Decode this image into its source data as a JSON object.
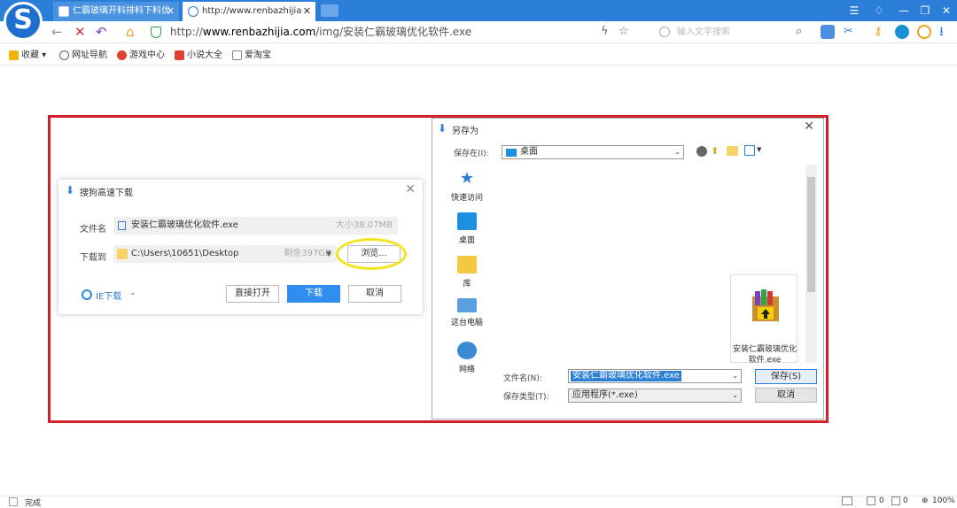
{
  "browser": {
    "tabs": [
      {
        "label": "仁霸玻璃开料排料下料优"
      },
      {
        "label": "http://www.renbazhijia"
      }
    ],
    "address": {
      "scheme": "http://",
      "host": "www.renbazhijia.com",
      "path": "/img/安装仁霸玻璃优化软件.exe"
    },
    "search_placeholder": "输入文字搜索",
    "bookmarks": [
      "收藏",
      "网址导航",
      "游戏中心",
      "小说大全",
      "爱淘宝"
    ],
    "status": {
      "left": "完成",
      "zoom": "100%",
      "count1": "0",
      "count2": "0"
    }
  },
  "sogou_dialog": {
    "title": "搜狗高速下载",
    "filename_label": "文件名",
    "filename_value": "安装仁霸玻璃优化软件.exe",
    "size_text": "大小38.07MB",
    "saveto_label": "下载到",
    "path_value": "C:\\Users\\10651\\Desktop",
    "free_text": "剩余397GB",
    "browse_button": "浏览...",
    "ie_link": "IE下载",
    "open_button": "直接打开",
    "download_button": "下载",
    "cancel_button": "取消"
  },
  "saveas_dialog": {
    "title": "另存为",
    "save_in_label": "保存在(I):",
    "save_in_value": "桌面",
    "places": [
      "快速访问",
      "桌面",
      "库",
      "这台电脑",
      "网络"
    ],
    "file_item": "安装仁霸玻璃优化软件.exe",
    "filename_label": "文件名(N):",
    "filename_value": "安装仁霸玻璃优化软件.exe",
    "filetype_label": "保存类型(T):",
    "filetype_value": "应用程序(*.exe)",
    "save_button": "保存(S)",
    "cancel_button": "取消"
  },
  "colors": {
    "accent": "#2b7fd8",
    "highlight_frame": "#d21f2b",
    "callout": "#f2e41a",
    "primary_button": "#2f8ef0"
  }
}
